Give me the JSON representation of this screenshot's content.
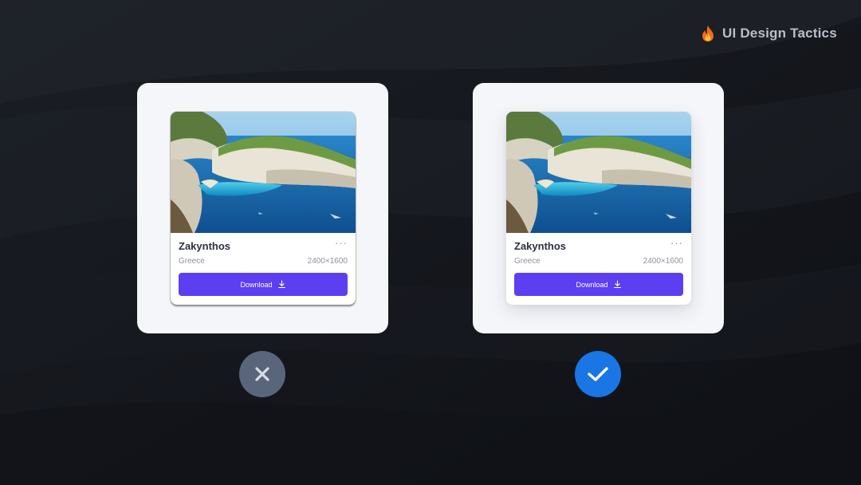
{
  "brand": {
    "name": "UI Design Tactics",
    "icon": "fire-icon"
  },
  "colors": {
    "background": "#14171d",
    "panel": "#f5f6f9",
    "accent_button": "#5b3ff0",
    "incorrect_badge": "#58657a",
    "correct_badge": "#1976e4"
  },
  "examples": [
    {
      "verdict": "incorrect",
      "verdict_icon": "x-icon",
      "card": {
        "title": "Zakynthos",
        "subtitle": "Greece",
        "dimensions": "2400×1600",
        "more_label": "···",
        "button_label": "Download",
        "button_icon": "download-icon"
      }
    },
    {
      "verdict": "correct",
      "verdict_icon": "check-icon",
      "card": {
        "title": "Zakynthos",
        "subtitle": "Greece",
        "dimensions": "2400×1600",
        "more_label": "···",
        "button_label": "Download",
        "button_icon": "download-icon"
      }
    }
  ]
}
